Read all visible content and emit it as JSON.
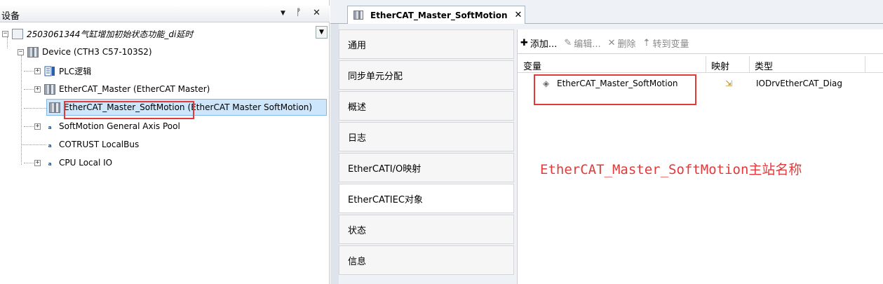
{
  "left_panel": {
    "title": "设备",
    "pin_glyph": "▼",
    "dock_glyph": "ᚡ",
    "close_glyph": "✕",
    "dropdown_glyph": "▼",
    "tree": [
      {
        "label": "2503061344气缸增加初始状态功能_di延时",
        "expander": "−"
      },
      {
        "label": "Device (CTH3 C57-103S2)",
        "expander": "−"
      },
      {
        "label": "PLC逻辑",
        "expander": "+"
      },
      {
        "label": "EtherCAT_Master (EtherCAT Master)",
        "expander": "+"
      },
      {
        "name": "EtherCAT_Master_SoftMotion",
        "suffix": "(EtherCAT Master SoftMotion)"
      },
      {
        "label": "SoftMotion General Axis Pool",
        "expander": "+"
      },
      {
        "label": "COTRUST LocalBus"
      },
      {
        "label": "CPU Local IO",
        "expander": "+"
      }
    ]
  },
  "editor": {
    "tab": {
      "label": "EtherCAT_Master_SoftMotion",
      "close": "✕"
    },
    "nav": [
      "通用",
      "同步单元分配",
      "概述",
      "日志",
      "EtherCATI/O映射",
      "EtherCATIEC对象",
      "状态",
      "信息"
    ],
    "active_nav": 5,
    "toolbar": {
      "add": {
        "icon": "✚",
        "label": "添加..."
      },
      "edit": {
        "icon": "✎",
        "label": "编辑..."
      },
      "delete": {
        "icon": "✕",
        "label": "删除"
      },
      "goto": {
        "icon": "⇡",
        "label": "转到变量"
      }
    },
    "grid": {
      "columns": [
        "变量",
        "映射",
        "类型"
      ],
      "rows": [
        {
          "variable": "EtherCAT_Master_SoftMotion",
          "mapping_icon": "⇲",
          "type": "IODrvEtherCAT_Diag"
        }
      ]
    },
    "annotation": "EtherCAT_Master_SoftMotion主站名称"
  },
  "colors": {
    "accent_red": "#e23a3a",
    "selection": "#cde6fb"
  }
}
